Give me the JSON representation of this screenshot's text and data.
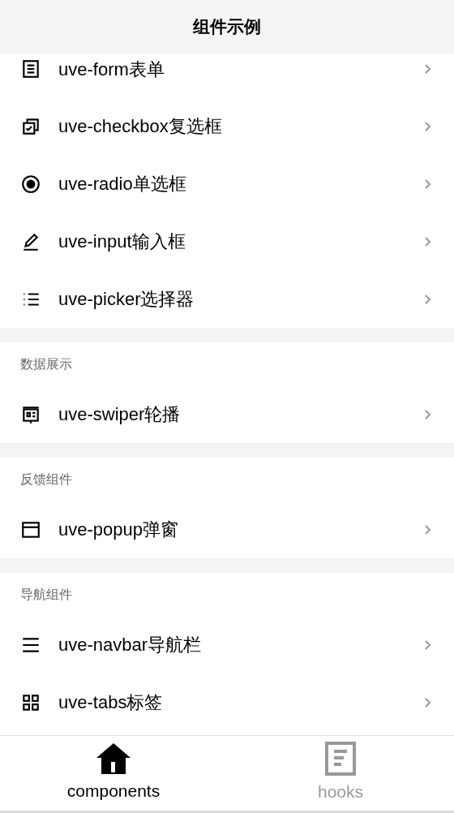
{
  "header": {
    "title": "组件示例"
  },
  "sections": [
    {
      "items": [
        {
          "label": "uve-form表单"
        },
        {
          "label": "uve-checkbox复选框"
        },
        {
          "label": "uve-radio单选框"
        },
        {
          "label": "uve-input输入框"
        },
        {
          "label": "uve-picker选择器"
        }
      ]
    },
    {
      "title": "数据展示",
      "items": [
        {
          "label": "uve-swiper轮播"
        }
      ]
    },
    {
      "title": "反馈组件",
      "items": [
        {
          "label": "uve-popup弹窗"
        }
      ]
    },
    {
      "title": "导航组件",
      "items": [
        {
          "label": "uve-navbar导航栏"
        },
        {
          "label": "uve-tabs标签"
        }
      ]
    }
  ],
  "tab_bar": [
    {
      "label": "components",
      "selected": true
    },
    {
      "label": "hooks",
      "selected": false
    }
  ]
}
